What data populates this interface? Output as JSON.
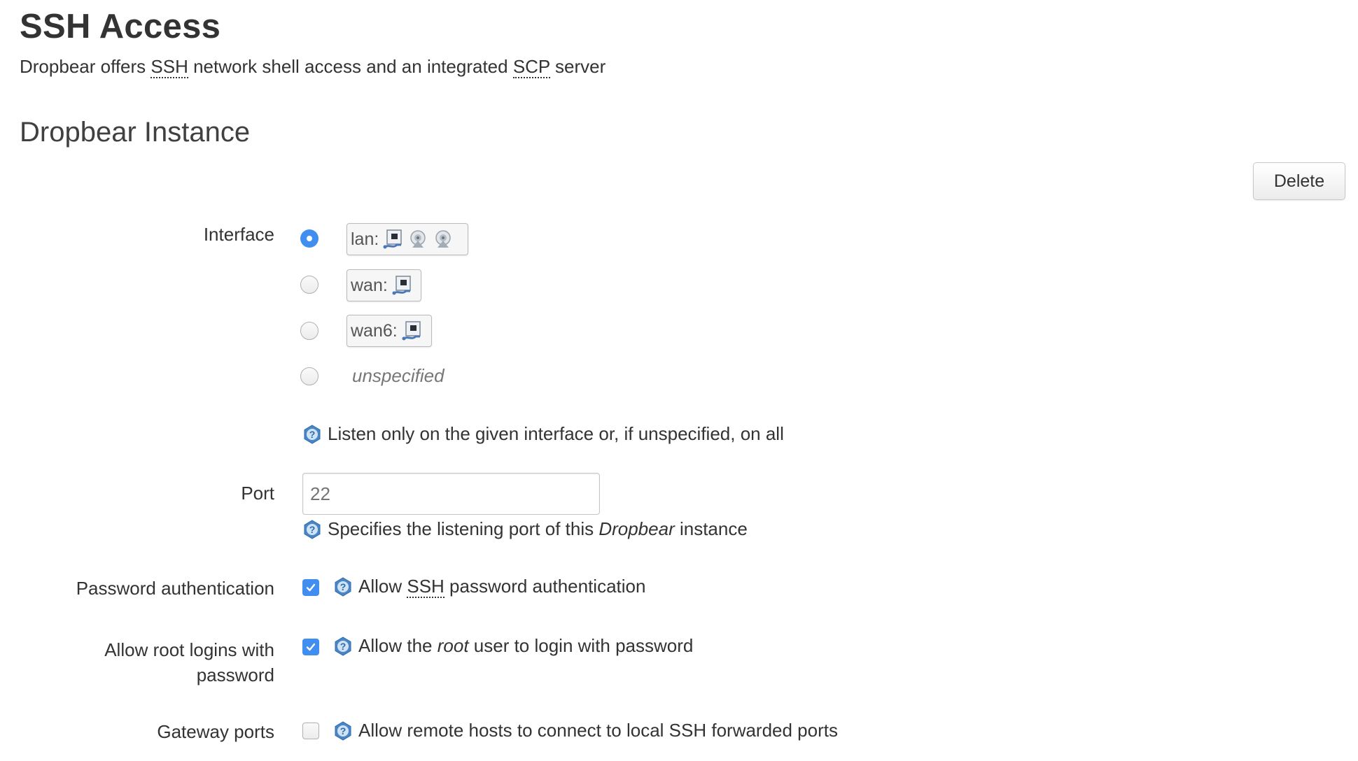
{
  "page": {
    "title": "SSH Access",
    "description": {
      "part1": "Dropbear offers ",
      "abbr1": "SSH",
      "part2": " network shell access and an integrated ",
      "abbr2": "SCP",
      "part3": " server"
    }
  },
  "section": {
    "title": "Dropbear Instance",
    "delete_label": "Delete"
  },
  "interface": {
    "label": "Interface",
    "options": [
      {
        "name": "lan:",
        "selected": true,
        "icons": [
          "ethernet-port-icon",
          "wireless-icon",
          "wireless-icon"
        ]
      },
      {
        "name": "wan:",
        "selected": false,
        "icons": [
          "ethernet-port-icon"
        ]
      },
      {
        "name": "wan6:",
        "selected": false,
        "icons": [
          "ethernet-port-icon"
        ]
      },
      {
        "name": "unspecified",
        "selected": false,
        "icons": []
      }
    ],
    "help": "Listen only on the given interface or, if unspecified, on all"
  },
  "port": {
    "label": "Port",
    "value": "",
    "placeholder": "22",
    "help": {
      "part1": "Specifies the listening port of this ",
      "emph": "Dropbear",
      "part2": " instance"
    }
  },
  "password_auth": {
    "label": "Password authentication",
    "checked": true,
    "help": {
      "part1": "Allow ",
      "abbr": "SSH",
      "part2": " password authentication"
    }
  },
  "root_login": {
    "label_line1": "Allow root logins with",
    "label_line2": "password",
    "checked": true,
    "help": {
      "part1": "Allow the ",
      "emph": "root",
      "part2": " user to login with password"
    }
  },
  "gateway_ports": {
    "label": "Gateway ports",
    "checked": false,
    "help": "Allow remote hosts to connect to local SSH forwarded ports"
  },
  "colors": {
    "accent": "#3f8ef0",
    "text": "#333333",
    "help_icon": "#4a86c5"
  }
}
